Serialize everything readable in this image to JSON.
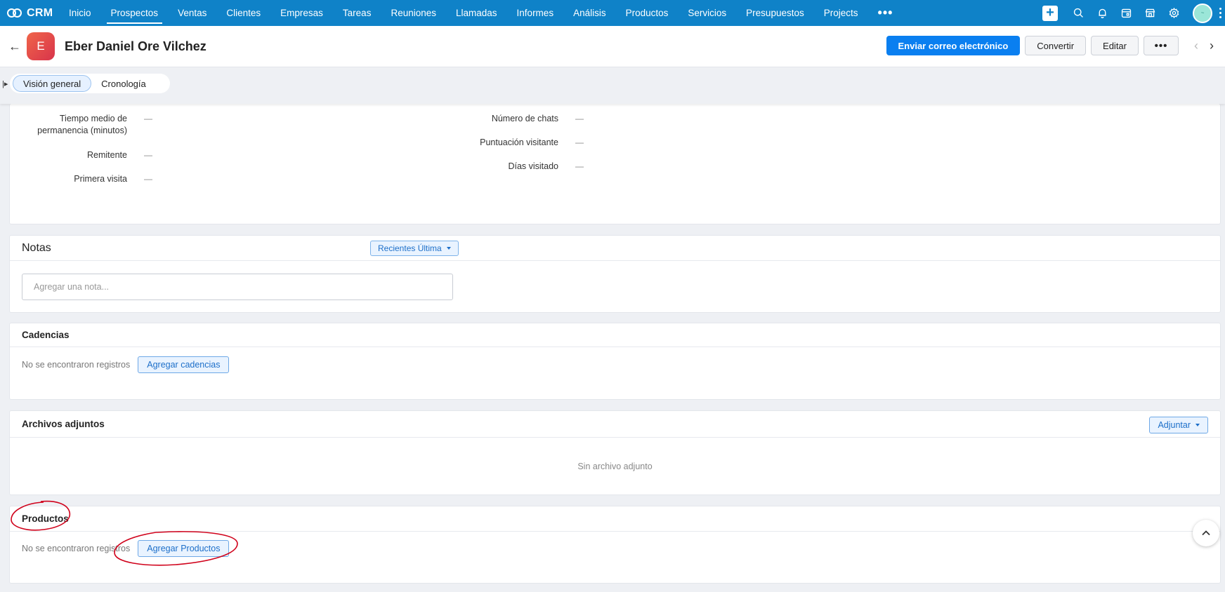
{
  "nav": {
    "brand": "CRM",
    "items": [
      {
        "label": "Inicio"
      },
      {
        "label": "Prospectos"
      },
      {
        "label": "Ventas"
      },
      {
        "label": "Clientes"
      },
      {
        "label": "Empresas"
      },
      {
        "label": "Tareas"
      },
      {
        "label": "Reuniones"
      },
      {
        "label": "Llamadas"
      },
      {
        "label": "Informes"
      },
      {
        "label": "Análisis"
      },
      {
        "label": "Productos"
      },
      {
        "label": "Servicios"
      },
      {
        "label": "Presupuestos"
      },
      {
        "label": "Projects"
      }
    ],
    "active_item": "Prospectos",
    "more": "•••",
    "icons": [
      "plus-icon",
      "search-icon",
      "bell-icon",
      "calendar-icon",
      "store-icon",
      "gear-icon"
    ]
  },
  "record": {
    "avatar_letter": "E",
    "name": "Eber Daniel Ore Vilchez",
    "actions": {
      "email": "Enviar correo electrónico",
      "convert": "Convertir",
      "edit": "Editar",
      "more": "•••"
    }
  },
  "tabs": [
    {
      "label": "Visión general",
      "active": true
    },
    {
      "label": "Cronología",
      "active": false
    }
  ],
  "visitor_info": {
    "left": [
      {
        "label": "Tiempo medio de permanencia (minutos)",
        "value": "—"
      },
      {
        "label": "Remitente",
        "value": "—"
      },
      {
        "label": "Primera visita",
        "value": "—"
      }
    ],
    "right": [
      {
        "label": "Número de chats",
        "value": "—"
      },
      {
        "label": "Puntuación visitante",
        "value": "—"
      },
      {
        "label": "Días visitado",
        "value": "—"
      }
    ]
  },
  "notes": {
    "title": "Notas",
    "sort_label": "Recientes Última",
    "placeholder": "Agregar una nota..."
  },
  "cadences": {
    "title": "Cadencias",
    "empty": "No se encontraron registros",
    "button": "Agregar cadencias"
  },
  "attachments": {
    "title": "Archivos adjuntos",
    "button": "Adjuntar",
    "empty": "Sin archivo adjunto"
  },
  "products": {
    "title": "Productos",
    "empty": "No se encontraron registros",
    "button": "Agregar Productos"
  },
  "colors": {
    "nav_bg": "#0f82c8",
    "primary_button": "#0a7ff0",
    "annotation": "#d0021b"
  }
}
